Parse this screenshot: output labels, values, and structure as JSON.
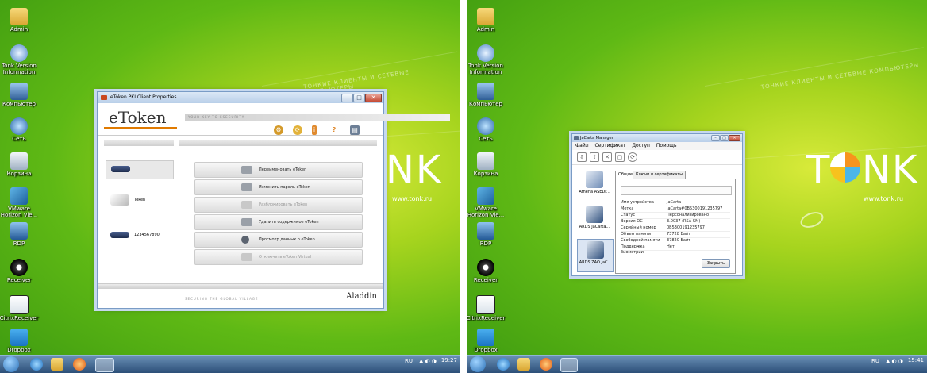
{
  "left_screen": {
    "desktop_icons": [
      {
        "label": "Admin",
        "icon": "folder-icon"
      },
      {
        "label": "Tonk Version Information",
        "icon": "info-icon"
      },
      {
        "label": "Компьютер",
        "icon": "computer-icon"
      },
      {
        "label": "Сеть",
        "icon": "network-icon"
      },
      {
        "label": "Корзина",
        "icon": "recycle-bin-icon"
      },
      {
        "label": "VMware Horizon Vie...",
        "icon": "vmware-icon"
      },
      {
        "label": "RDP",
        "icon": "rdp-icon"
      },
      {
        "label": "Receiver",
        "icon": "receiver-icon"
      },
      {
        "label": "CitrixReceiver",
        "icon": "citrix-icon"
      },
      {
        "label": "Dropbox",
        "icon": "dropbox-icon"
      }
    ],
    "wallpaper": {
      "slogan": "ТОНКИЕ КЛИЕНТЫ И СЕТЕВЫЕ КОМПЬЮТЕРЫ",
      "brand": "NK",
      "url": "www.tonk.ru"
    },
    "taskbar": {
      "tray_lang": "RU",
      "clock_time": "19:27"
    },
    "window": {
      "title": "eToken PKI Client Properties",
      "logo": "eToken",
      "tagline": "YOUR KEY TO ESECURITY",
      "tokens": [
        {
          "label": ""
        },
        {
          "label": "Token"
        },
        {
          "label": "1234567890"
        }
      ],
      "actions": [
        {
          "label": "Переименовать eToken",
          "enabled": true
        },
        {
          "label": "Изменить пароль eToken",
          "enabled": true
        },
        {
          "label": "Разблокировать eToken",
          "enabled": false
        },
        {
          "label": "Удалить содержимое eToken",
          "enabled": true
        },
        {
          "label": "Просмотр данных о eToken",
          "enabled": true
        },
        {
          "label": "Отключить eToken Virtual",
          "enabled": false
        }
      ],
      "footer_slogan": "SECURING THE GLOBAL VILLAGE",
      "footer_brand": "Aladdin"
    }
  },
  "right_screen": {
    "desktop_icons": [
      {
        "label": "Admin",
        "icon": "folder-icon"
      },
      {
        "label": "Tonk Version Information",
        "icon": "info-icon"
      },
      {
        "label": "Компьютер",
        "icon": "computer-icon"
      },
      {
        "label": "Сеть",
        "icon": "network-icon"
      },
      {
        "label": "Корзина",
        "icon": "recycle-bin-icon"
      },
      {
        "label": "VMware Horizon Vie...",
        "icon": "vmware-icon"
      },
      {
        "label": "RDP",
        "icon": "rdp-icon"
      },
      {
        "label": "Receiver",
        "icon": "receiver-icon"
      },
      {
        "label": "CitrixReceiver",
        "icon": "citrix-icon"
      },
      {
        "label": "Dropbox",
        "icon": "dropbox-icon"
      }
    ],
    "wallpaper": {
      "slogan": "ТОНКИЕ КЛИЕНТЫ И СЕТЕВЫЕ КОМПЬЮТЕРЫ",
      "brand_left": "T",
      "brand_right": "NK",
      "url": "www.tonk.ru"
    },
    "taskbar": {
      "tray_lang": "RU",
      "clock_time": "15:41"
    },
    "window": {
      "title": "JaCarta Manager",
      "menu": [
        "Файл",
        "Сертификат",
        "Доступ",
        "Помощь"
      ],
      "devices": [
        {
          "label": "Athena ASEDr..."
        },
        {
          "label": "ARDS JaCarta..."
        },
        {
          "label": "ARDS ZAO JaC..."
        }
      ],
      "tabs": [
        "Общие",
        "Ключи и сертификаты"
      ],
      "properties": [
        {
          "key": "Имя устройства",
          "value": "JaCarta"
        },
        {
          "key": "Метка",
          "value": "JaCarta#0B5300191235797"
        },
        {
          "key": "Статус",
          "value": "Персонализировано"
        },
        {
          "key": "Версия ОС",
          "value": "3.0037 (RSA-SM)"
        },
        {
          "key": "Серийный номер",
          "value": "0B5300191235797"
        },
        {
          "key": "Объем памяти",
          "value": "73728 Байт"
        },
        {
          "key": "Свободной памяти",
          "value": "37820 Байт"
        },
        {
          "key": "Поддержка биометрии",
          "value": "Нет"
        }
      ],
      "close_label": "Закрыть"
    }
  }
}
